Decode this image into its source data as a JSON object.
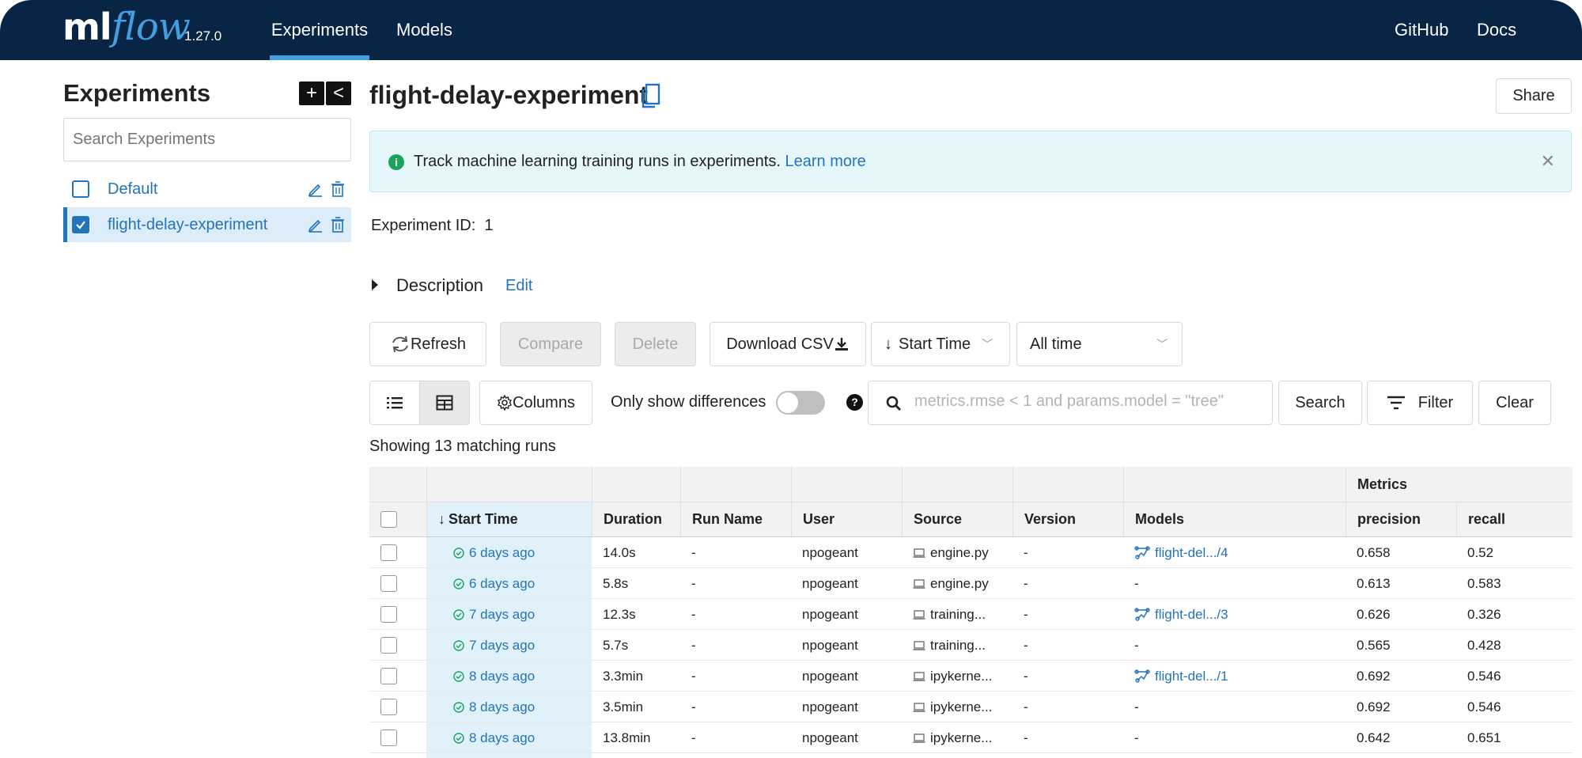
{
  "header": {
    "logo_ml": "ml",
    "logo_flow": "flow",
    "version": "1.27.0",
    "nav": [
      "Experiments",
      "Models"
    ],
    "nav_active": "Experiments",
    "right_links": [
      "GitHub",
      "Docs"
    ],
    "accent_color": "#43a0e0",
    "background_color": "#082545"
  },
  "sidebar": {
    "title": "Experiments",
    "add_icon": "plus-icon",
    "collapse_icon": "chevron-left-icon",
    "search_placeholder": "Search Experiments",
    "experiments": [
      {
        "name": "Default",
        "checked": false
      },
      {
        "name": "flight-delay-experiment",
        "checked": true
      }
    ]
  },
  "main": {
    "title": "flight-delay-experiment",
    "share_label": "Share",
    "banner": {
      "text": "Track machine learning training runs in experiments.",
      "link": "Learn more"
    },
    "experiment_id_label": "Experiment ID:",
    "experiment_id_value": "1",
    "description_label": "Description",
    "description_edit": "Edit",
    "buttons": {
      "refresh": "Refresh",
      "compare": "Compare",
      "delete": "Delete",
      "download_csv": "Download CSV",
      "sort": "Start Time",
      "time_range": "All time",
      "columns": "Columns",
      "only_show_differences": "Only show differences",
      "search": "Search",
      "filter": "Filter",
      "clear": "Clear"
    },
    "search_placeholder": "metrics.rmse < 1 and params.model = \"tree\"",
    "matching_runs": "Showing 13 matching runs"
  },
  "table": {
    "group_header": "Metrics",
    "columns": [
      "Start Time",
      "Duration",
      "Run Name",
      "User",
      "Source",
      "Version",
      "Models",
      "precision",
      "recall"
    ],
    "rows": [
      {
        "start": "6 days ago",
        "duration": "14.0s",
        "run_name": "-",
        "user": "npogeant",
        "source": "engine.py",
        "version": "-",
        "model": "flight-del.../4",
        "precision": "0.658",
        "recall": "0.52"
      },
      {
        "start": "6 days ago",
        "duration": "5.8s",
        "run_name": "-",
        "user": "npogeant",
        "source": "engine.py",
        "version": "-",
        "model": "-",
        "precision": "0.613",
        "recall": "0.583"
      },
      {
        "start": "7 days ago",
        "duration": "12.3s",
        "run_name": "-",
        "user": "npogeant",
        "source": "training...",
        "version": "-",
        "model": "flight-del.../3",
        "precision": "0.626",
        "recall": "0.326"
      },
      {
        "start": "7 days ago",
        "duration": "5.7s",
        "run_name": "-",
        "user": "npogeant",
        "source": "training...",
        "version": "-",
        "model": "-",
        "precision": "0.565",
        "recall": "0.428"
      },
      {
        "start": "8 days ago",
        "duration": "3.3min",
        "run_name": "-",
        "user": "npogeant",
        "source": "ipykerne...",
        "version": "-",
        "model": "flight-del.../1",
        "precision": "0.692",
        "recall": "0.546"
      },
      {
        "start": "8 days ago",
        "duration": "3.5min",
        "run_name": "-",
        "user": "npogeant",
        "source": "ipykerne...",
        "version": "-",
        "model": "-",
        "precision": "0.692",
        "recall": "0.546"
      },
      {
        "start": "8 days ago",
        "duration": "13.8min",
        "run_name": "-",
        "user": "npogeant",
        "source": "ipykerne...",
        "version": "-",
        "model": "-",
        "precision": "0.642",
        "recall": "0.651"
      }
    ]
  }
}
